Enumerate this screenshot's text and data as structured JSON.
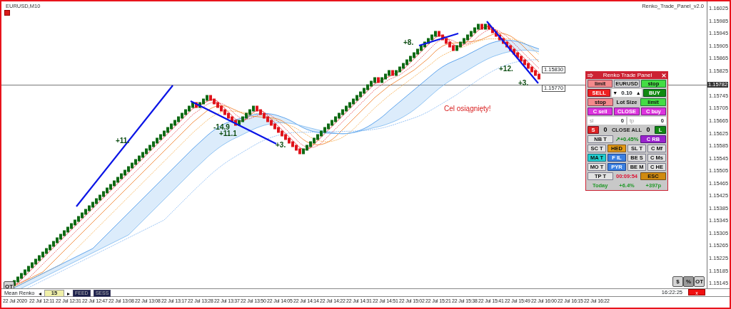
{
  "chart": {
    "symbol": "EURUSD,M10",
    "indicator": "Renko_Trade_Panel_v2.0",
    "message": "Cel osiągnięty!",
    "trade_labels": [
      "+8.",
      "+12.",
      "+3.",
      "-14.9",
      "+11.1",
      "+3.",
      "+11."
    ],
    "price_tags": [
      "1.15830",
      "1.15770"
    ]
  },
  "price_axis": {
    "ticks": [
      "1.16025",
      "1.15985",
      "1.15945",
      "1.15905",
      "1.15865",
      "1.15825",
      "1.15745",
      "1.15705",
      "1.15665",
      "1.15625",
      "1.15585",
      "1.15545",
      "1.15505",
      "1.15465",
      "1.15425",
      "1.15385",
      "1.15345",
      "1.15305",
      "1.15265",
      "1.15225",
      "1.15185",
      "1.15145"
    ],
    "current_price": "1.15782"
  },
  "corner_buttons_left": [
    {
      "label": "OT",
      "selected": false
    }
  ],
  "corner_buttons_right": [
    {
      "label": "$",
      "selected": false
    },
    {
      "label": "%",
      "selected": true
    },
    {
      "label": "OT",
      "selected": false
    }
  ],
  "panel": {
    "title": "Renko Trade Panel",
    "rows": [
      {
        "items": [
          {
            "kind": "button",
            "label": "limit",
            "color": "#f48a8c"
          },
          {
            "kind": "button",
            "label": "EURUSD",
            "color": "#d8d8d8"
          },
          {
            "kind": "button",
            "label": "stop",
            "color": "#44dd44"
          }
        ]
      },
      {
        "items": [
          {
            "kind": "button",
            "label": "SELL",
            "color": "#ee2020"
          },
          {
            "kind": "stepper",
            "down": "▼",
            "value": "0.10",
            "up": "▲"
          },
          {
            "kind": "button",
            "label": "BUY",
            "color": "#108a10"
          }
        ]
      },
      {
        "items": [
          {
            "kind": "button",
            "label": "stop",
            "color": "#f48a8c"
          },
          {
            "kind": "text",
            "label": "Lot Size",
            "color": "#111111"
          },
          {
            "kind": "button",
            "label": "limit",
            "color": "#44dd44"
          }
        ]
      },
      {
        "items": [
          {
            "kind": "button",
            "label": "C sell",
            "color": "#dd33dd"
          },
          {
            "kind": "button",
            "label": "CLOSE",
            "color": "#dd33dd"
          },
          {
            "kind": "button",
            "label": "C buy",
            "color": "#dd33dd"
          }
        ]
      },
      {
        "items": [
          {
            "kind": "field",
            "label": "sl",
            "value": "0"
          },
          {
            "kind": "field",
            "label": "tp",
            "value": "0"
          }
        ]
      },
      {
        "items": [
          {
            "kind": "button",
            "label": "S",
            "color": "#dd2222"
          },
          {
            "kind": "text",
            "label": "0",
            "color": "#000000"
          },
          {
            "kind": "text",
            "label": "CLOSE ALL",
            "color": "#222222"
          },
          {
            "kind": "text",
            "label": "0",
            "color": "#000000"
          },
          {
            "kind": "button",
            "label": "L",
            "color": "#118811"
          }
        ]
      },
      {
        "items": [
          {
            "kind": "button",
            "label": "NB T",
            "color": "#e2e2e2"
          },
          {
            "kind": "text",
            "label": "↗+0.45%",
            "color": "#11881a"
          },
          {
            "kind": "button",
            "label": "C RB",
            "color": "#9a22cc"
          }
        ]
      },
      {
        "items": [
          {
            "kind": "button",
            "label": "SC T",
            "color": "#e2e2e2"
          },
          {
            "kind": "button",
            "label": "HED",
            "color": "#e39a14"
          },
          {
            "kind": "button",
            "label": "SL T",
            "color": "#e2e2e2"
          },
          {
            "kind": "button",
            "label": "C Mf",
            "color": "#e2e2e2"
          }
        ]
      },
      {
        "items": [
          {
            "kind": "button",
            "label": "MA T",
            "color": "#22d0d0"
          },
          {
            "kind": "button",
            "label": "F IL",
            "color": "#3a7fe0"
          },
          {
            "kind": "button",
            "label": "BE S",
            "color": "#e2e2e2"
          },
          {
            "kind": "button",
            "label": "C Ms",
            "color": "#e2e2e2"
          }
        ]
      },
      {
        "items": [
          {
            "kind": "button",
            "label": "MO T",
            "color": "#e2e2e2"
          },
          {
            "kind": "button",
            "label": "PYR",
            "color": "#3a7fe0"
          },
          {
            "kind": "button",
            "label": "BE M",
            "color": "#e2e2e2"
          },
          {
            "kind": "button",
            "label": "C HE",
            "color": "#e2e2e2"
          }
        ]
      },
      {
        "items": [
          {
            "kind": "button",
            "label": "TP T",
            "color": "#e2e2e2"
          },
          {
            "kind": "text",
            "label": "00:09:54",
            "color": "#dd1133"
          },
          {
            "kind": "button",
            "label": "ESC",
            "color": "#d08a10"
          }
        ]
      },
      {
        "items": [
          {
            "kind": "text",
            "label": "Today",
            "color": "#22992a"
          },
          {
            "kind": "text",
            "label": "+6.4%",
            "color": "#22992a"
          },
          {
            "kind": "text",
            "label": "+397p",
            "color": "#22992a"
          }
        ]
      }
    ]
  },
  "subwindow": {
    "name": "Mean Renko",
    "prev": "◂",
    "value": "15",
    "next": "▸",
    "buttons": [
      "FEED",
      "SESS"
    ],
    "clock": "16:22:25",
    "alert": "x"
  },
  "time_axis": {
    "labels": [
      "22 Jul 2020",
      "22 Jul 12:11",
      "22 Jul 12:31",
      "22 Jul 12:47",
      "22 Jul 13:08",
      "22 Jul 13:08",
      "22 Jul 13:17",
      "22 Jul 13:28",
      "22 Jul 13:37",
      "22 Jul 13:50",
      "22 Jul 14:05",
      "22 Jul 14:14",
      "22 Jul 14:22",
      "22 Jul 14:31",
      "22 Jul 14:51",
      "22 Jul 15:02",
      "22 Jul 15:21",
      "22 Jul 15:38",
      "22 Jul 15:41",
      "22 Jul 15:49",
      "22 Jul 16:00",
      "22 Jul 16:15",
      "22 Jul 16:22"
    ]
  }
}
